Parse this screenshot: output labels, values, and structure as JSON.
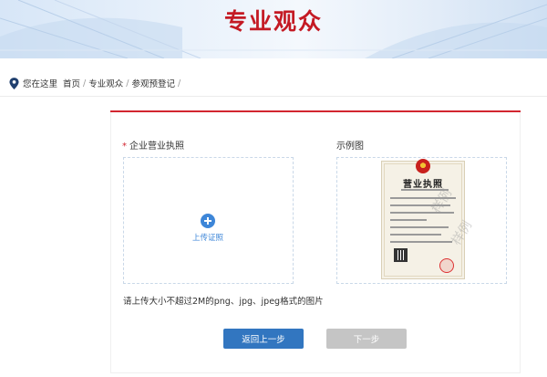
{
  "banner": {
    "title": "专业观众"
  },
  "breadcrumb": {
    "prefix": "您在这里",
    "items": [
      "首页",
      "专业观众",
      "参观预登记"
    ],
    "separator": "/"
  },
  "form": {
    "required_mark": "*",
    "field_label": "企业营业执照",
    "example_label": "示例图",
    "upload_text": "上传证照",
    "hint": "请上传大小不超过2M的png、jpg、jpeg格式的图片"
  },
  "example": {
    "license_title": "营业执照",
    "watermark": "样例"
  },
  "buttons": {
    "back": "返回上一步",
    "next": "下一步"
  },
  "colors": {
    "accent_red": "#d22630",
    "primary_blue": "#3276c0",
    "disabled_gray": "#c5c5c5"
  }
}
